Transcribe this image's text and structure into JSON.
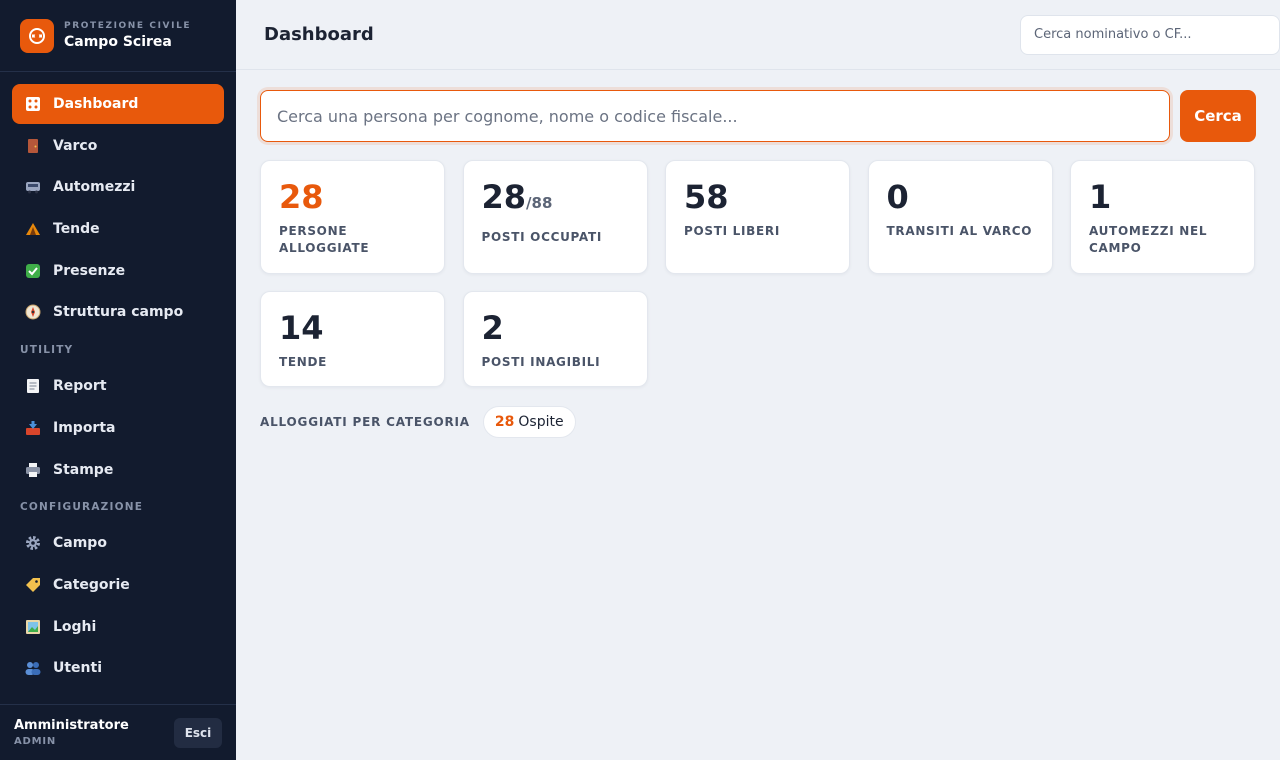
{
  "brand": {
    "subtitle": "PROTEZIONE CIVILE",
    "title": "Campo Scirea"
  },
  "nav": {
    "items": [
      {
        "label": "Dashboard",
        "icon": "dashboard-icon",
        "active": true
      },
      {
        "label": "Varco",
        "icon": "door-icon"
      },
      {
        "label": "Automezzi",
        "icon": "bus-icon"
      },
      {
        "label": "Tende",
        "icon": "tent-icon"
      },
      {
        "label": "Presenze",
        "icon": "check-icon"
      },
      {
        "label": "Struttura campo",
        "icon": "compass-icon"
      }
    ],
    "utility_label": "UTILITY",
    "utility": [
      {
        "label": "Report",
        "icon": "document-icon"
      },
      {
        "label": "Importa",
        "icon": "inbox-icon"
      },
      {
        "label": "Stampe",
        "icon": "printer-icon"
      }
    ],
    "config_label": "CONFIGURAZIONE",
    "config": [
      {
        "label": "Campo",
        "icon": "gear-icon"
      },
      {
        "label": "Categorie",
        "icon": "tag-icon"
      },
      {
        "label": "Loghi",
        "icon": "picture-icon"
      },
      {
        "label": "Utenti",
        "icon": "users-icon"
      }
    ]
  },
  "user": {
    "name": "Amministratore",
    "role": "ADMIN",
    "logout_label": "Esci"
  },
  "header": {
    "title": "Dashboard",
    "search_placeholder": "Cerca nominativo o CF..."
  },
  "search": {
    "placeholder": "Cerca una persona per cognome, nome o codice fiscale...",
    "button_label": "Cerca"
  },
  "stats": {
    "persone": {
      "value": "28",
      "label": "PERSONE ALLOGGIATE"
    },
    "posti_occupati": {
      "value": "28",
      "total": "/88",
      "label": "POSTI OCCUPATI"
    },
    "posti_liberi": {
      "value": "58",
      "label": "POSTI LIBERI"
    },
    "transiti": {
      "value": "0",
      "label": "TRANSITI AL VARCO"
    },
    "automezzi": {
      "value": "1",
      "label": "AUTOMEZZI NEL CAMPO"
    },
    "tende": {
      "value": "14",
      "label": "TENDE"
    },
    "inagibili": {
      "value": "2",
      "label": "POSTI INAGIBILI"
    }
  },
  "categories": {
    "title": "ALLOGGIATI PER CATEGORIA",
    "items": [
      {
        "count": "28",
        "name": "Ospite"
      }
    ]
  },
  "colors": {
    "accent": "#e8590c",
    "sidebar_bg": "#121b2e",
    "page_bg": "#eef1f6"
  }
}
